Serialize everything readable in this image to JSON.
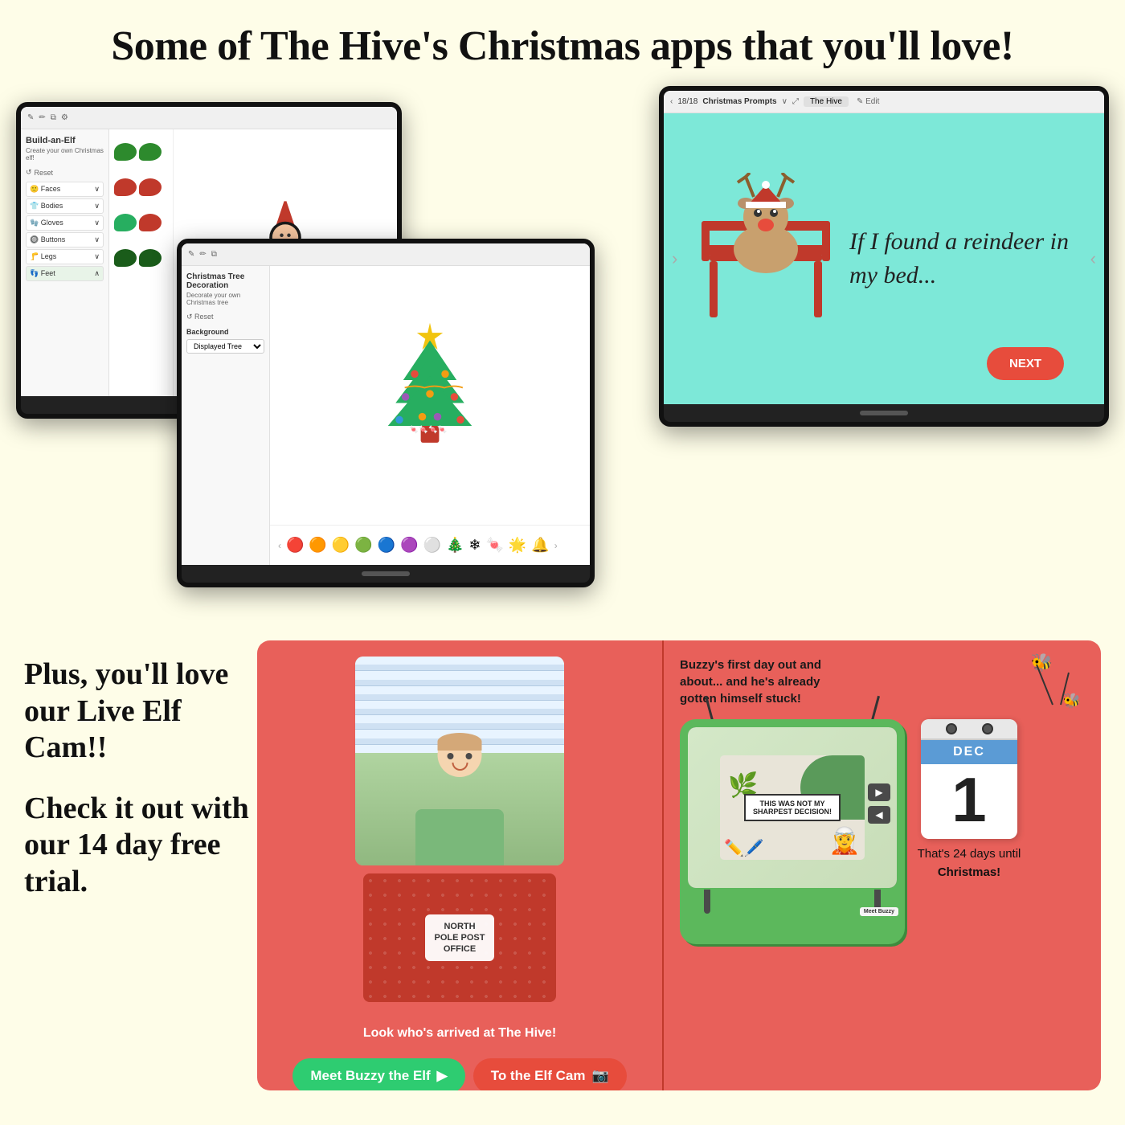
{
  "page": {
    "background_color": "#fefde8",
    "header": {
      "title": "Some of The Hive's Christmas apps that you'll love!"
    },
    "screens": {
      "left": {
        "title": "Build-an-Elf",
        "subtitle": "Create your own Christmas elf!",
        "categories": [
          "Faces",
          "Bodies",
          "Gloves",
          "Buttons",
          "Legs",
          "Feet"
        ],
        "reset_label": "Reset"
      },
      "right": {
        "brand": "The Hive",
        "edit_label": "Edit",
        "counter": "18/18",
        "section": "Christmas Prompts",
        "prompt_text": "If I found a reindeer in my bed...",
        "next_label": "NEXT"
      },
      "center": {
        "title": "Christmas Tree Decoration",
        "subtitle": "Decorate your own Christmas tree",
        "reset_label": "Reset",
        "background_label": "Background",
        "background_value": "Displayed Tree"
      }
    },
    "bottom": {
      "left_text": "Plus, you'll love our Live Elf Cam!! \n\nCheck it out with our 14 day free trial.",
      "left_text_lines": [
        "Plus, you'll",
        "love our Live",
        "Elf Cam!!",
        "",
        "Check it out",
        "with our 14",
        "day free trial."
      ],
      "card_left": {
        "caption": "Look who's arrived at The Hive!",
        "btn_meet_buzzy": "Meet Buzzy the Elf",
        "btn_elf_cam": "To the Elf Cam",
        "pkg_line1": "NORTH",
        "pkg_line2": "POLE POST",
        "pkg_line3": "OFFICE"
      },
      "card_right": {
        "buzzy_text": "Buzzy's first day out and about... and he's already gotten himself stuck!",
        "sign_text": "THIS WAS NOT MY SHARPEST DECISION!",
        "meet_buzzy_label": "Meet Buzzy",
        "calendar": {
          "month": "DEC",
          "day": "1",
          "countdown_text": "That's 24 days until Christmas!"
        }
      }
    }
  }
}
